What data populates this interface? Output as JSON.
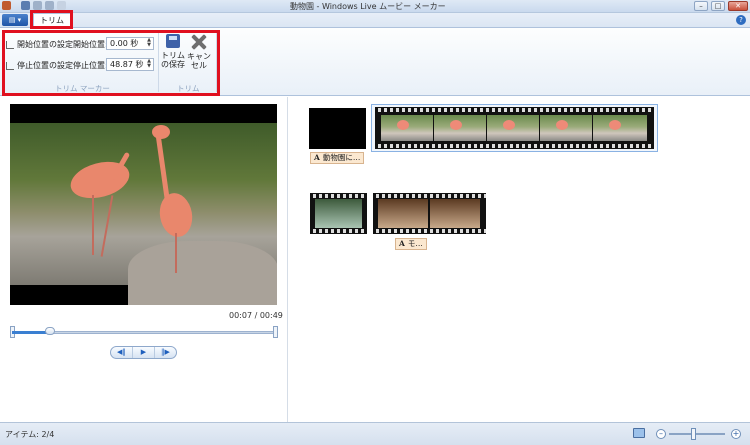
{
  "window": {
    "title": "動物園 - Windows Live ムービー メーカー",
    "controls": [
      "–",
      "□",
      "✕"
    ]
  },
  "menu": {
    "app_button": "▤ ▾",
    "help": "?"
  },
  "tabs": [
    {
      "label": "トリム",
      "active": true
    }
  ],
  "ribbon": {
    "trim_marker_group": {
      "label": "トリム マーカー",
      "set_start_label": "開始位置の設定",
      "set_end_label": "停止位置の設定",
      "start_field_label": "開始位置:",
      "start_value": "0.00 秒",
      "end_field_label": "停止位置:",
      "end_value": "48.87 秒"
    },
    "trim_group": {
      "label": "トリム",
      "save_label": "トリム\nの保存",
      "cancel_label": "キャン\nセル"
    }
  },
  "preview": {
    "timecode": "00:07 / 00:49",
    "position_fraction": 0.143,
    "buttons": [
      "◀‖",
      "▶",
      "‖▶"
    ]
  },
  "storyboard": {
    "captions": [
      "動物園に…",
      "モ…"
    ]
  },
  "status": {
    "items_text": "アイテム: 2/4",
    "zoom_out": "–",
    "zoom_in": "+"
  },
  "colors": {
    "highlight": "#e0101f",
    "accent": "#2d6cc0"
  }
}
